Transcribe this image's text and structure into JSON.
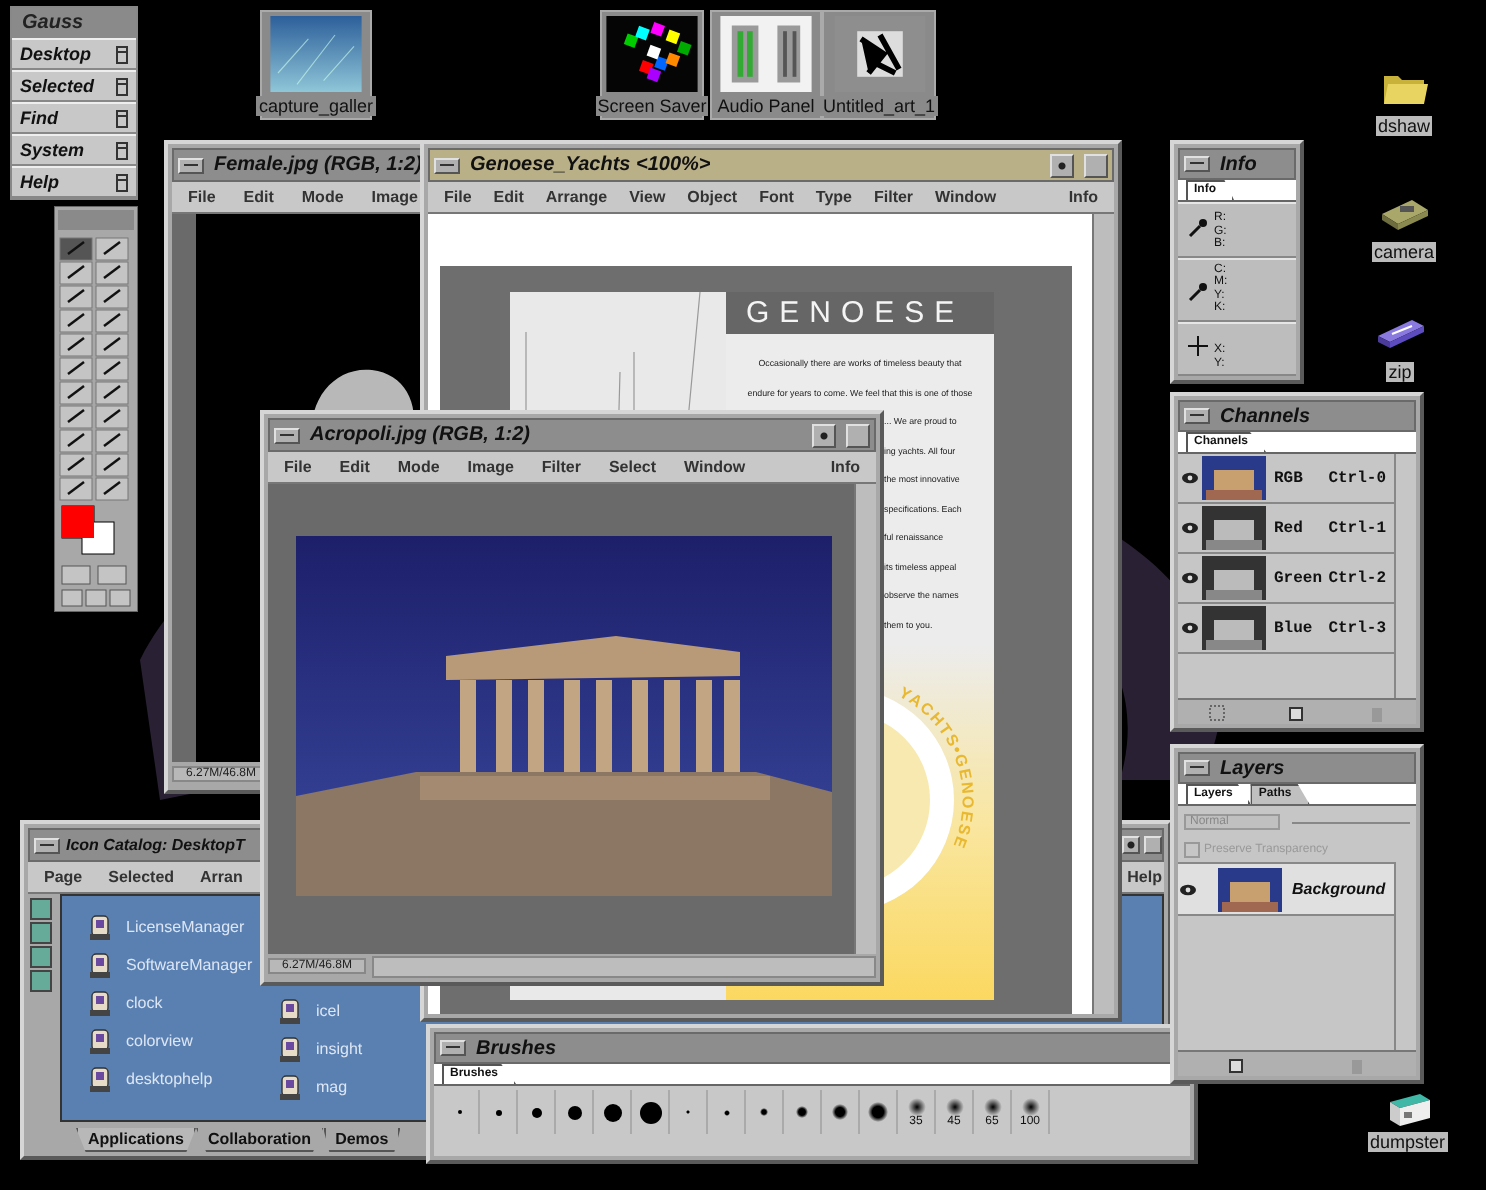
{
  "toolchest": {
    "title": "Gauss",
    "items": [
      "Desktop",
      "Selected",
      "Find",
      "System",
      "Help"
    ]
  },
  "desktop_icons": [
    {
      "label": "capture_galler",
      "kind": "photo"
    },
    {
      "label": "Screen Saver",
      "kind": "screensaver"
    },
    {
      "label": "Audio Panel",
      "kind": "audio"
    },
    {
      "label": "Untitled_art_1",
      "kind": "art"
    },
    {
      "label": "dshaw",
      "kind": "folder"
    },
    {
      "label": "camera",
      "kind": "camera"
    },
    {
      "label": "zip",
      "kind": "zip"
    },
    {
      "label": "dumpster",
      "kind": "dumpster"
    }
  ],
  "icon_catalog": {
    "title": "Icon Catalog: DesktopT",
    "active": false,
    "menus": [
      "Page",
      "Selected",
      "Arran"
    ],
    "menus_right": [
      "Help"
    ],
    "columns": [
      [
        "LicenseManager",
        "SoftwareManager",
        "clock",
        "colorview",
        "desktophelp"
      ],
      [
        "icel",
        "insight",
        "mag"
      ]
    ],
    "tabs": [
      {
        "label": "Applications",
        "selected": true
      },
      {
        "label": "Collaboration",
        "selected": false
      },
      {
        "label": "Demos",
        "selected": false
      }
    ]
  },
  "female_window": {
    "title": "Female.jpg  (RGB, 1:2)",
    "active": false,
    "menus": [
      "File",
      "Edit",
      "Mode",
      "Image"
    ],
    "status": "6.27M/46.8M"
  },
  "genoese_window": {
    "title": "Genoese_Yachts <100%>",
    "active": true,
    "menus": [
      "File",
      "Edit",
      "Arrange",
      "View",
      "Object",
      "Font",
      "Type",
      "Filter",
      "Window"
    ],
    "menus_right": [
      "Info"
    ],
    "heading": "GENOESE",
    "paragraph_lines": [
      {
        "text": "Occasionally there are works of timeless beauty that",
        "kind": "full"
      },
      {
        "text": "endure for years to come. We feel that this is one of those",
        "kind": "full"
      },
      {
        "text": "... We are proud to",
        "kind": "cut"
      },
      {
        "text": "ing yachts. All four",
        "kind": "cut"
      },
      {
        "text": "the most innovative",
        "kind": "cut"
      },
      {
        "text": "specifications. Each",
        "kind": "cut"
      },
      {
        "text": "ful renaissance",
        "kind": "cut"
      },
      {
        "text": "its timeless appeal",
        "kind": "cut"
      },
      {
        "text": "observe the names",
        "kind": "cut"
      },
      {
        "text": "them to you.",
        "kind": "cut"
      }
    ],
    "logo_text": "YACHTS•GENOESE"
  },
  "acropoli_window": {
    "title": "Acropoli.jpg  (RGB, 1:2)",
    "active": false,
    "menus": [
      "File",
      "Edit",
      "Mode",
      "Image",
      "Filter",
      "Select",
      "Window"
    ],
    "menus_right": [
      "Info"
    ],
    "status": "6.27M/46.8M"
  },
  "brushes_panel": {
    "title": "Brushes",
    "active": false,
    "tabs": [
      {
        "label": "Brushes",
        "selected": true
      }
    ],
    "brush_labels": [
      "35",
      "45",
      "65",
      "100"
    ]
  },
  "info_panel": {
    "title": "Info",
    "active": false,
    "tabs": [
      {
        "label": "Info",
        "selected": true
      }
    ],
    "sections": [
      {
        "kind": "eyedropper",
        "labels": [
          "R:",
          "G:",
          "B:"
        ]
      },
      {
        "kind": "eyedropper",
        "labels": [
          "C:",
          "M:",
          "Y:",
          "K:"
        ]
      },
      {
        "kind": "crosshair",
        "labels": [
          "X:",
          "Y:"
        ]
      }
    ]
  },
  "channels_panel": {
    "title": "Channels",
    "active": false,
    "tabs": [
      {
        "label": "Channels",
        "selected": true
      }
    ],
    "channels": [
      {
        "name": "RGB",
        "shortcut": "Ctrl-0",
        "kind": "color",
        "visible": true
      },
      {
        "name": "Red",
        "shortcut": "Ctrl-1",
        "kind": "gray",
        "visible": true
      },
      {
        "name": "Green",
        "shortcut": "Ctrl-2",
        "kind": "gray",
        "visible": true
      },
      {
        "name": "Blue",
        "shortcut": "Ctrl-3",
        "kind": "gray",
        "visible": true
      }
    ]
  },
  "layers_panel": {
    "title": "Layers",
    "active": false,
    "tabs": [
      {
        "label": "Layers",
        "selected": true
      },
      {
        "label": "Paths",
        "selected": false
      }
    ],
    "blend_mode": {
      "value": "Normal",
      "disabled": true
    },
    "preserve_transparency": {
      "label": "Preserve Transparency",
      "checked": false,
      "disabled": true
    },
    "layers": [
      {
        "name": "Background",
        "visible": true
      }
    ]
  }
}
